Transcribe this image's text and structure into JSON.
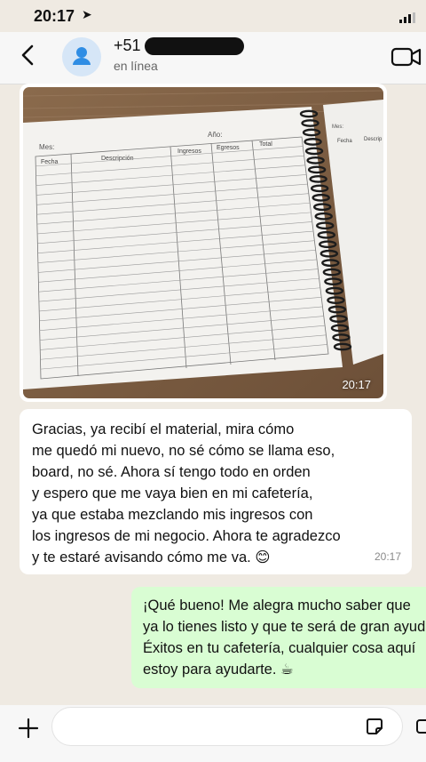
{
  "status_bar": {
    "time": "20:17"
  },
  "header": {
    "contact_prefix": "+51",
    "presence": "en línea"
  },
  "messages": {
    "image": {
      "time": "20:17"
    },
    "incoming": {
      "lines": [
        "Gracias, ya recibí el material, mira cómo",
        "me quedó mi nuevo, no sé cómo se llama eso,",
        "board, no sé. Ahora sí tengo todo en orden",
        "y espero que me vaya bien en mi cafetería,",
        "ya que estaba mezclando mis ingresos con",
        "los ingresos de mi negocio. Ahora te agradezco",
        "y te estaré avisando cómo me va. 😊"
      ],
      "time": "20:17"
    },
    "outgoing": {
      "lines": [
        "¡Qué bueno! Me alegra mucho saber que",
        "ya lo tienes listo y que te será de gran ayuda.",
        "Éxitos en tu cafetería, cualquier cosa aquí",
        "estoy para ayudarte. ☕"
      ]
    }
  },
  "ledger": {
    "month_label": "Mes:",
    "year_label": "Año:",
    "columns": [
      "Fecha",
      "Descripción",
      "Ingresos",
      "Egresos",
      "Total"
    ],
    "right_page_month": "Mes:",
    "right_page_columns": [
      "Fecha",
      "Descrip"
    ]
  }
}
